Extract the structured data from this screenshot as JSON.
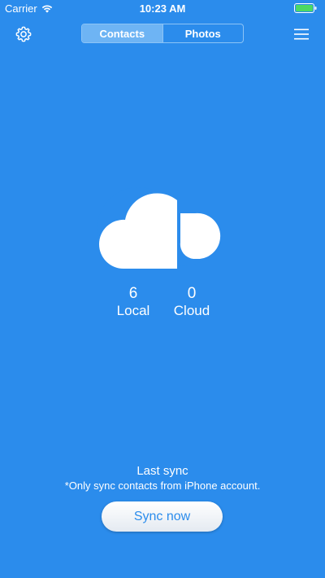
{
  "status_bar": {
    "carrier": "Carrier",
    "time": "10:23 AM"
  },
  "nav": {
    "tabs": [
      {
        "label": "Contacts",
        "active": true
      },
      {
        "label": "Photos",
        "active": false
      }
    ],
    "settings_icon": "gear-icon",
    "menu_icon": "hamburger-menu-icon"
  },
  "stats": {
    "local": {
      "value": "6",
      "label": "Local"
    },
    "cloud": {
      "value": "0",
      "label": "Cloud"
    }
  },
  "sync": {
    "last_sync_label": "Last sync",
    "note": "*Only sync contacts from iPhone account.",
    "button_label": "Sync now"
  },
  "colors": {
    "background": "#2b8cec",
    "accent": "#2b8cec",
    "battery": "#4cd964"
  }
}
